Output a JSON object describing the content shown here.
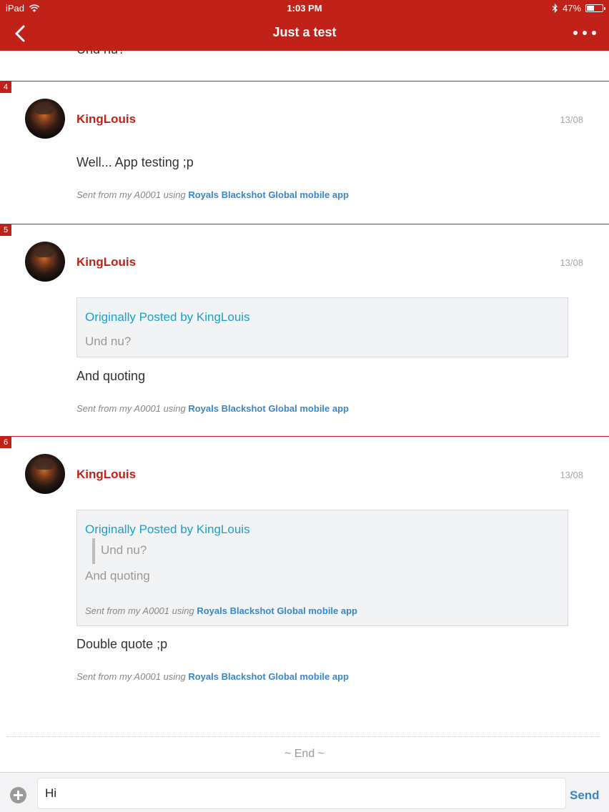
{
  "status_bar": {
    "device": "iPad",
    "time": "1:03 PM",
    "battery": "47%",
    "battery_level": 0.47
  },
  "nav": {
    "title": "Just a test",
    "back_icon": "chevron-left-icon",
    "more_icon": "more-horizontal-icon"
  },
  "previous_post_tail": "Und nu?",
  "posts": [
    {
      "number": "4",
      "author": "KingLouis",
      "date": "13/08",
      "body": "Well... App testing ;p",
      "signature": {
        "prefix": "Sent from my A0001 using ",
        "app": "Royals Blackshot Global mobile app"
      }
    },
    {
      "number": "5",
      "author": "KingLouis",
      "date": "13/08",
      "quote": {
        "header": "Originally Posted by KingLouis",
        "text": "Und nu?"
      },
      "body": "And quoting",
      "signature": {
        "prefix": "Sent from my A0001 using ",
        "app": "Royals Blackshot Global mobile app"
      }
    },
    {
      "number": "6",
      "author": "KingLouis",
      "date": "13/08",
      "quote": {
        "header": "Originally Posted by KingLouis",
        "nested_text": "Und nu?",
        "text": "And quoting",
        "signature": {
          "prefix": "Sent from my A0001 using ",
          "app": "Royals Blackshot Global mobile app"
        }
      },
      "body": "Double quote ;p",
      "signature": {
        "prefix": "Sent from my A0001 using ",
        "app": "Royals Blackshot Global mobile app"
      }
    }
  ],
  "end_marker": "~ End ~",
  "reply": {
    "value": "Hi",
    "send_label": "Send",
    "add_icon": "plus-circle-icon"
  },
  "colors": {
    "brand": "#c0221a",
    "link": "#3a86c8",
    "quote_header": "#1aa0cf"
  }
}
